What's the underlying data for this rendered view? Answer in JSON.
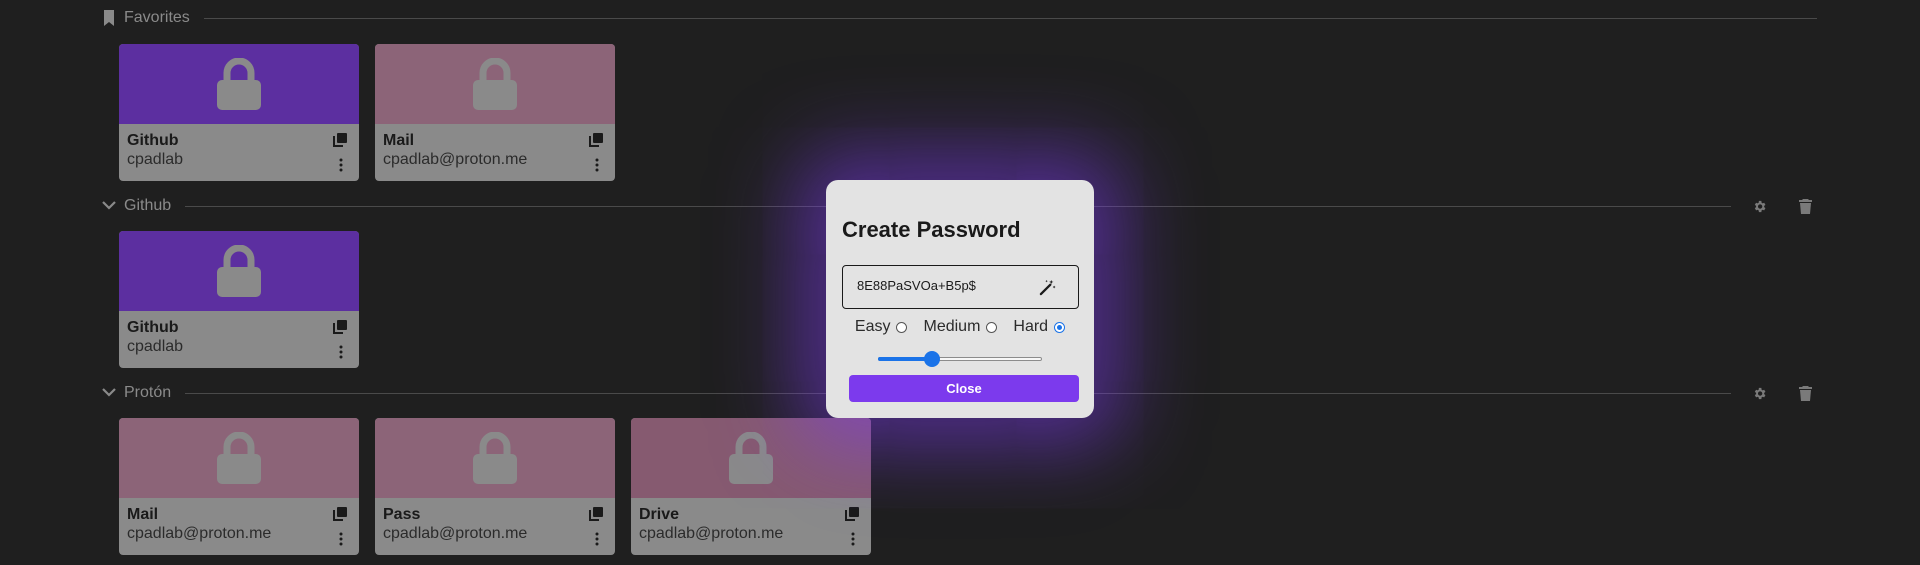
{
  "colors": {
    "background": "#1f1f1f",
    "github_card": "#5c2fa0",
    "proton_card": "#8c6478",
    "card_body": "#8a8a8a",
    "accent": "#7c3aed",
    "slider": "#1a73e8"
  },
  "sections": {
    "favorites": {
      "title": "Favorites",
      "icon": "bookmark-icon"
    },
    "github": {
      "title": "Github",
      "icon": "chevron-down-icon"
    },
    "proton": {
      "title": "Protón",
      "icon": "chevron-down-icon"
    }
  },
  "cards": {
    "fav_github": {
      "name": "Github",
      "user": "cpadlab"
    },
    "fav_mail": {
      "name": "Mail",
      "user": "cpadlab@proton.me"
    },
    "github_github": {
      "name": "Github",
      "user": "cpadlab"
    },
    "proton_mail": {
      "name": "Mail",
      "user": "cpadlab@proton.me"
    },
    "proton_pass": {
      "name": "Pass",
      "user": "cpadlab@proton.me"
    },
    "proton_drive": {
      "name": "Drive",
      "user": "cpadlab@proton.me"
    }
  },
  "modal": {
    "title": "Create Password",
    "password": "8E88PaSVOa+B5p$",
    "options": {
      "easy": "Easy",
      "medium": "Medium",
      "hard": "Hard"
    },
    "selected": "Hard",
    "length_fraction": 0.33,
    "close_label": "Close"
  }
}
